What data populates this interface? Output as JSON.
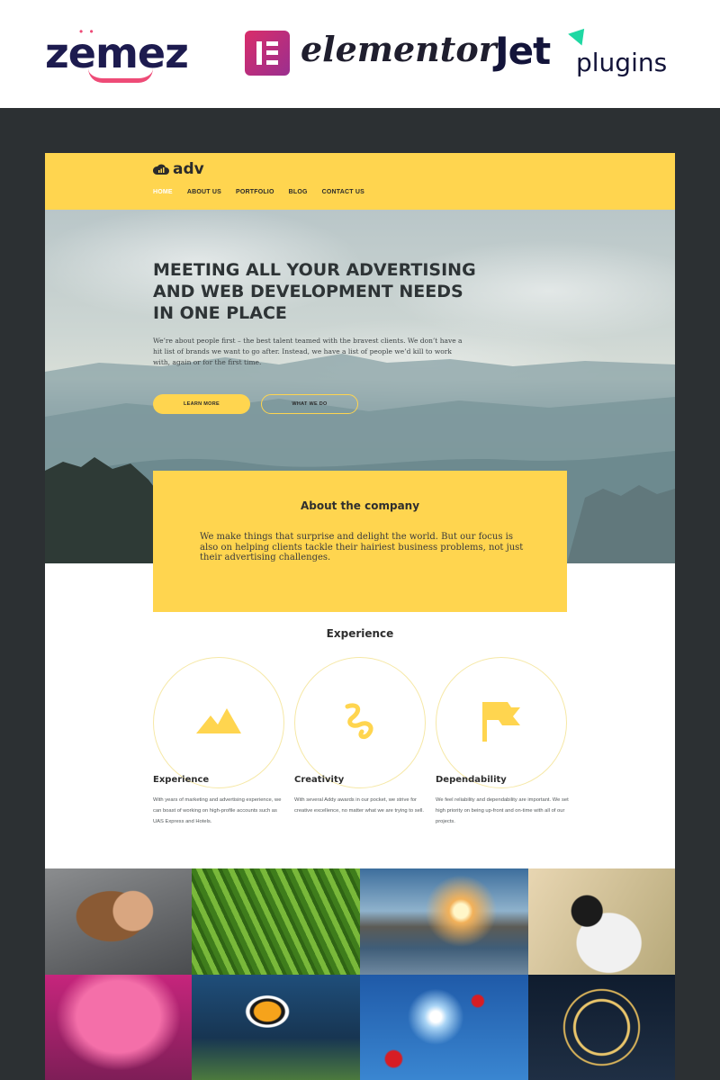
{
  "brands": {
    "zemez": "zemez",
    "elementor": "elementor",
    "jet": "Jet",
    "plugins": "plugins"
  },
  "site": {
    "logo_text": "adv",
    "nav": [
      {
        "label": "HOME",
        "active": true
      },
      {
        "label": "ABOUT US",
        "active": false
      },
      {
        "label": "PORTFOLIO",
        "active": false
      },
      {
        "label": "BLOG",
        "active": false
      },
      {
        "label": "CONTACT US",
        "active": false
      }
    ],
    "hero": {
      "title": "MEETING ALL YOUR ADVERTISING AND WEB DEVELOPMENT NEEDS IN ONE PLACE",
      "text": "We’re about people first – the best talent teamed with the bravest clients. We don’t have a hit list of brands we want to go after. Instead, we have a list of people we’d kill to work with, again or for the first time.",
      "primary_button": "LEARN MORE",
      "secondary_button": "WHAT WE DO"
    },
    "about": {
      "title": "About the company",
      "text": "We make things that surprise and delight the world. But our focus is also on helping clients tackle their hairiest business problems, not just their advertising challenges."
    },
    "experience": {
      "title": "Experience",
      "features": [
        {
          "icon": "mountain-icon",
          "title": "Experience",
          "text": "With years of marketing and advertising experience, we can boast of working on high-profile accounts such as UAS Express and Hotels."
        },
        {
          "icon": "squiggle-icon",
          "title": "Creativity",
          "text": "With several Addy awards in our pocket, we strive for creative excellence, no matter what we are trying to sell."
        },
        {
          "icon": "flag-icon",
          "title": "Dependability",
          "text": "We feel reliability and dependability are important. We set high priority on being up-front and on-time with all of our projects."
        }
      ]
    },
    "gallery": [
      "photographer-woman-photo",
      "grass-photo",
      "seashore-sunset-photo",
      "camera-girl-photo",
      "pink-tree-photo",
      "clownfish-photo",
      "poppies-sky-photo",
      "ferris-wheel-photo"
    ]
  },
  "colors": {
    "accent": "#ffd54f",
    "background": "#2c3033",
    "text_dark": "#2e3436"
  }
}
